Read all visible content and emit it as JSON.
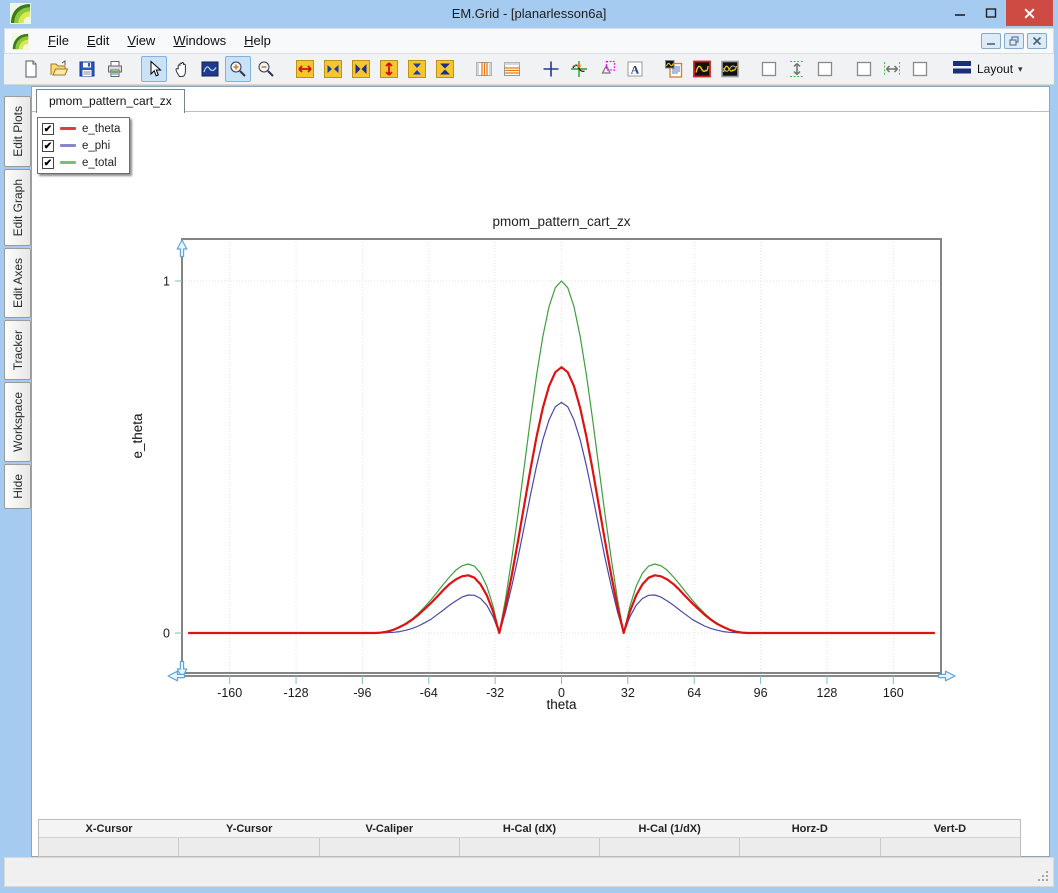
{
  "window": {
    "title": "EM.Grid - [planarlesson6a]"
  },
  "window_controls": [
    "minimize",
    "maximize",
    "close"
  ],
  "menu": {
    "items": [
      "File",
      "Edit",
      "View",
      "Windows",
      "Help"
    ]
  },
  "mdi_controls": [
    "minimize",
    "restore",
    "close"
  ],
  "toolbar": {
    "groups": [
      [
        "new-file",
        "open-file",
        "save-file",
        "print"
      ],
      [
        "select-pointer",
        "pan-hand",
        "nav-trace",
        "zoom-in",
        "zoom-out"
      ],
      [
        "h-expand",
        "h-arrows",
        "h-compress",
        "v-expand",
        "v-arrows",
        "v-compress"
      ],
      [
        "grid-columns",
        "grid-rows"
      ],
      [
        "crosshair",
        "tracker-cursor",
        "caliper",
        "text-label"
      ],
      [
        "report",
        "trace-view",
        "multi-trace-view"
      ],
      [
        "slot-box-a",
        "v-spread",
        "slot-box-b"
      ],
      [
        "slot-box-c",
        "h-spread",
        "slot-box-d"
      ]
    ],
    "active": [
      "select-pointer",
      "zoom-in"
    ],
    "layout_label": "Layout"
  },
  "sidebar": {
    "tabs": [
      "Edit Plots",
      "Edit Graph",
      "Edit Axes",
      "Tracker",
      "Workspace",
      "Hide"
    ]
  },
  "doc_tab": {
    "label": "pmom_pattern_cart_zx"
  },
  "legend": {
    "items": [
      {
        "label": "e_theta",
        "checked": true,
        "color": "#e23b3b"
      },
      {
        "label": "e_phi",
        "checked": true,
        "color": "#8787cb"
      },
      {
        "label": "e_total",
        "checked": true,
        "color": "#7dbb7d"
      }
    ]
  },
  "cursor_table": {
    "headers": [
      "X-Cursor",
      "Y-Cursor",
      "V-Caliper",
      "H-Cal (dX)",
      "H-Cal (1/dX)",
      "Horz-D",
      "Vert-D"
    ],
    "values": [
      "",
      "",
      "",
      "",
      "",
      "",
      ""
    ]
  },
  "chart_data": {
    "type": "line",
    "title": "pmom_pattern_cart_zx",
    "xlabel": "theta",
    "ylabel": "e_theta",
    "xlim": [
      -183,
      183
    ],
    "ylim": [
      -0.11,
      1.12
    ],
    "xticks": [
      -160,
      -128,
      -96,
      -64,
      -32,
      0,
      32,
      64,
      96,
      128,
      160
    ],
    "yticks": [
      0,
      1
    ],
    "grid": true,
    "legend_position": "top-left",
    "x": [
      -180,
      -177,
      -174,
      -171,
      -168,
      -165,
      -162,
      -159,
      -156,
      -153,
      -150,
      -147,
      -144,
      -141,
      -138,
      -135,
      -132,
      -129,
      -126,
      -123,
      -120,
      -117,
      -114,
      -111,
      -108,
      -105,
      -102,
      -99,
      -96,
      -93,
      -90,
      -87,
      -84,
      -81,
      -78,
      -75,
      -72,
      -69,
      -66,
      -63,
      -60,
      -57,
      -54,
      -51,
      -48,
      -45,
      -42,
      -39,
      -36,
      -33,
      -30,
      -27,
      -24,
      -21,
      -18,
      -15,
      -12,
      -9,
      -6,
      -3,
      0,
      3,
      6,
      9,
      12,
      15,
      18,
      21,
      24,
      27,
      30,
      33,
      36,
      39,
      42,
      45,
      48,
      51,
      54,
      57,
      60,
      63,
      66,
      69,
      72,
      75,
      78,
      81,
      84,
      87,
      90,
      93,
      96,
      99,
      102,
      105,
      108,
      111,
      114,
      117,
      120,
      123,
      126,
      129,
      132,
      135,
      138,
      141,
      144,
      147,
      150,
      153,
      156,
      159,
      162,
      165,
      168,
      171,
      174,
      177,
      180
    ],
    "series": [
      {
        "name": "e_theta",
        "color": "#dd1212",
        "width": 2.2,
        "values": [
          0,
          0,
          0,
          0,
          0,
          0,
          0,
          0,
          0,
          0,
          0,
          0,
          0,
          0,
          0,
          0,
          0,
          0,
          0,
          0,
          0,
          0,
          0,
          0,
          0,
          0,
          0,
          0,
          0,
          0,
          0,
          0.001,
          0.004,
          0.009,
          0.017,
          0.026,
          0.038,
          0.052,
          0.068,
          0.085,
          0.103,
          0.122,
          0.139,
          0.152,
          0.161,
          0.164,
          0.157,
          0.138,
          0.107,
          0.061,
          0,
          0.075,
          0.163,
          0.261,
          0.363,
          0.464,
          0.558,
          0.639,
          0.702,
          0.741,
          0.755,
          0.741,
          0.702,
          0.639,
          0.558,
          0.464,
          0.363,
          0.261,
          0.163,
          0.075,
          0,
          0.061,
          0.107,
          0.138,
          0.157,
          0.164,
          0.161,
          0.152,
          0.139,
          0.122,
          0.103,
          0.085,
          0.068,
          0.052,
          0.038,
          0.026,
          0.017,
          0.009,
          0.004,
          0.001,
          0,
          0,
          0,
          0,
          0,
          0,
          0,
          0,
          0,
          0,
          0,
          0,
          0,
          0,
          0,
          0,
          0,
          0,
          0,
          0,
          0,
          0,
          0,
          0,
          0,
          0,
          0,
          0,
          0,
          0,
          0
        ]
      },
      {
        "name": "e_phi",
        "color": "#4949a8",
        "width": 1.2,
        "values": [
          0,
          0,
          0,
          0,
          0,
          0,
          0,
          0,
          0,
          0,
          0,
          0,
          0,
          0,
          0,
          0,
          0,
          0,
          0,
          0,
          0,
          0,
          0,
          0,
          0,
          0,
          0,
          0,
          0,
          0,
          0,
          0,
          0.001,
          0.002,
          0.004,
          0.008,
          0.013,
          0.02,
          0.029,
          0.039,
          0.052,
          0.065,
          0.079,
          0.091,
          0.102,
          0.108,
          0.107,
          0.098,
          0.079,
          0.046,
          0,
          0.06,
          0.132,
          0.214,
          0.302,
          0.391,
          0.475,
          0.549,
          0.606,
          0.643,
          0.655,
          0.643,
          0.606,
          0.549,
          0.475,
          0.391,
          0.302,
          0.214,
          0.132,
          0.06,
          0,
          0.046,
          0.079,
          0.098,
          0.107,
          0.108,
          0.102,
          0.091,
          0.079,
          0.065,
          0.052,
          0.039,
          0.029,
          0.02,
          0.013,
          0.008,
          0.004,
          0.002,
          0.001,
          0,
          0,
          0,
          0,
          0,
          0,
          0,
          0,
          0,
          0,
          0,
          0,
          0,
          0,
          0,
          0,
          0,
          0,
          0,
          0,
          0,
          0,
          0,
          0,
          0,
          0,
          0,
          0,
          0,
          0,
          0,
          0
        ]
      },
      {
        "name": "e_total",
        "color": "#3f9e3f",
        "width": 1.2,
        "values": [
          0,
          0,
          0,
          0,
          0,
          0,
          0,
          0,
          0,
          0,
          0,
          0,
          0,
          0,
          0,
          0,
          0,
          0,
          0,
          0,
          0,
          0,
          0,
          0,
          0,
          0,
          0,
          0,
          0,
          0,
          0,
          0.001,
          0.004,
          0.01,
          0.017,
          0.028,
          0.04,
          0.056,
          0.074,
          0.094,
          0.116,
          0.138,
          0.159,
          0.178,
          0.191,
          0.196,
          0.19,
          0.17,
          0.133,
          0.076,
          0,
          0.096,
          0.21,
          0.337,
          0.472,
          0.607,
          0.733,
          0.842,
          0.928,
          0.981,
          1,
          0.981,
          0.928,
          0.842,
          0.733,
          0.607,
          0.472,
          0.337,
          0.21,
          0.096,
          0,
          0.076,
          0.133,
          0.17,
          0.19,
          0.196,
          0.191,
          0.178,
          0.159,
          0.138,
          0.116,
          0.094,
          0.074,
          0.056,
          0.04,
          0.028,
          0.017,
          0.01,
          0.004,
          0.001,
          0,
          0,
          0,
          0,
          0,
          0,
          0,
          0,
          0,
          0,
          0,
          0,
          0,
          0,
          0,
          0,
          0,
          0,
          0,
          0,
          0,
          0,
          0,
          0,
          0,
          0,
          0,
          0,
          0,
          0,
          0,
          0
        ]
      }
    ]
  }
}
